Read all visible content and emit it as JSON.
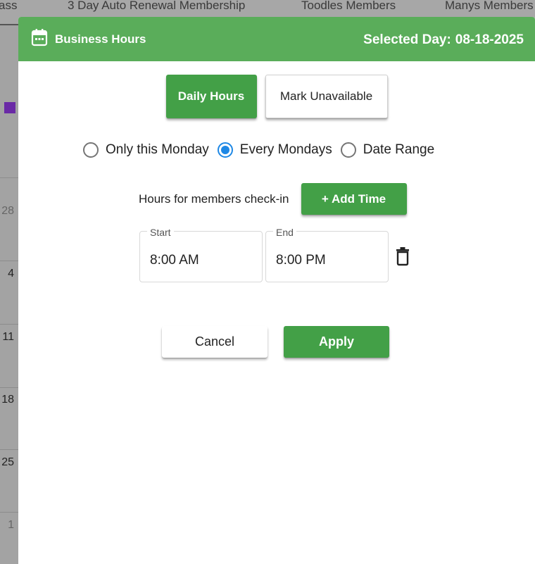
{
  "background": {
    "tabs": [
      "ass",
      "3 Day Auto Renewal Membership",
      "Toodles Members",
      "Manys Members"
    ],
    "calendar_days": [
      "28",
      "4",
      "11",
      "18",
      "25",
      "1"
    ],
    "swatch_color": "#6a2aa6"
  },
  "modal": {
    "header": {
      "icon": "calendar-icon",
      "title": "Business Hours",
      "selected_day_label": "Selected Day:",
      "selected_day_value": "08-18-2025",
      "color": "#5aad5a"
    },
    "toggle": {
      "daily_hours": "Daily Hours",
      "mark_unavailable": "Mark Unavailable",
      "active": "Daily Hours"
    },
    "recurrence": {
      "options": [
        "Only this Monday",
        "Every Mondays",
        "Date Range"
      ],
      "selected": "Every Mondays"
    },
    "checkin": {
      "label": "Hours for members check-in",
      "add_time": "+ Add Time"
    },
    "time_slot": {
      "start_label": "Start",
      "start_value": "8:00 AM",
      "end_label": "End",
      "end_value": "8:00 PM",
      "delete_icon": "trash-icon"
    },
    "actions": {
      "cancel": "Cancel",
      "apply": "Apply"
    },
    "accent_green": "#43a047",
    "radio_blue": "#1e88e5"
  }
}
